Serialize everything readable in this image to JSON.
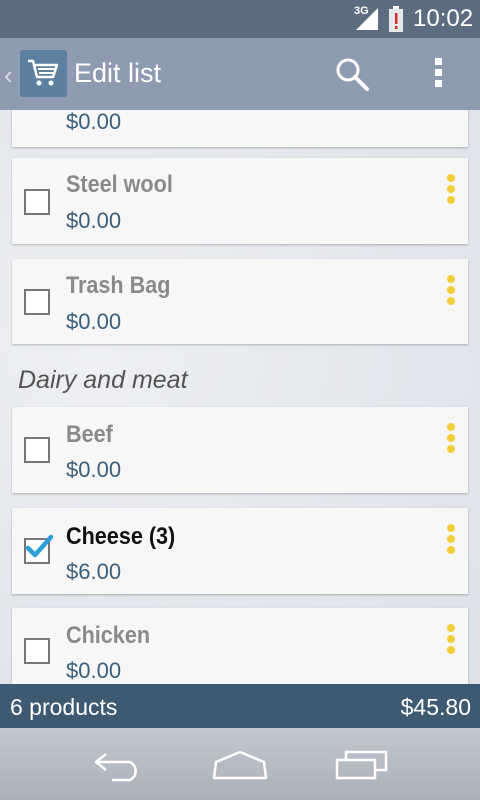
{
  "status_bar": {
    "network": "3G",
    "clock": "10:02",
    "icons": [
      "signal-icon",
      "battery-alert-icon"
    ]
  },
  "action_bar": {
    "title": "Edit list",
    "icons": [
      "back-caret-icon",
      "shopping-cart-icon",
      "search-icon",
      "overflow-menu-icon"
    ]
  },
  "list": {
    "items_top": [
      {
        "name": "",
        "price": "$0.00",
        "checked": false
      },
      {
        "name": "Steel wool",
        "price": "$0.00",
        "checked": false
      },
      {
        "name": "Trash Bag",
        "price": "$0.00",
        "checked": false
      }
    ],
    "section_header": "Dairy and meat",
    "items_section": [
      {
        "name": "Beef",
        "price": "$0.00",
        "checked": false
      },
      {
        "name": "Cheese (3)",
        "price": "$6.00",
        "checked": true
      },
      {
        "name": "Chicken",
        "price": "$0.00",
        "checked": false
      }
    ]
  },
  "summary": {
    "count": "6 products",
    "total": "$45.80"
  },
  "nav_bar": {
    "icons": [
      "back-icon",
      "home-icon",
      "recent-apps-icon"
    ]
  },
  "colors": {
    "status_bar": "#5e6c82",
    "action_bar": "#8e9bb1",
    "price_text": "#3b5f7c",
    "summary_bar": "#3d5a72",
    "more_dots": "#f2cf3a",
    "check_mark": "#2a9fd8"
  }
}
